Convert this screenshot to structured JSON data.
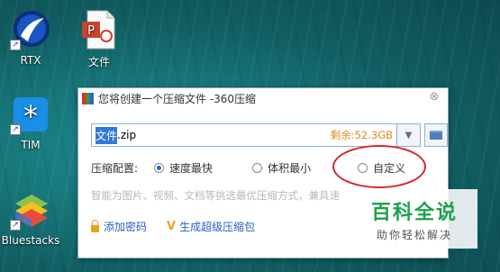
{
  "desktop": {
    "icons": [
      {
        "label": "RTX"
      },
      {
        "label": "文件"
      },
      {
        "label": "TIM"
      },
      {
        "label": "Bluestacks"
      }
    ]
  },
  "dialog": {
    "title": "您将创建一个压缩文件 -360压缩",
    "close_glyph": "⊗",
    "path": {
      "selected": "文件",
      "extension": ".zip"
    },
    "remaining_space": "剩余:52.3GB",
    "config_label": "压缩配置:",
    "options": [
      {
        "label": "速度最快",
        "selected": true
      },
      {
        "label": "体积最小",
        "selected": false
      },
      {
        "label": "自定义",
        "selected": false
      }
    ],
    "hint": "智能为图片、视频、文档等挑选最优压缩方式，兼具速",
    "add_password": "添加密码",
    "super_compress": "生成超级压缩包"
  },
  "watermark": {
    "title": "百科全说",
    "subtitle": "助你轻松解决"
  },
  "colors": {
    "annotation": "#d2282a",
    "link": "#2860c4",
    "selection": "#3179d6",
    "space": "#e08a1e"
  }
}
